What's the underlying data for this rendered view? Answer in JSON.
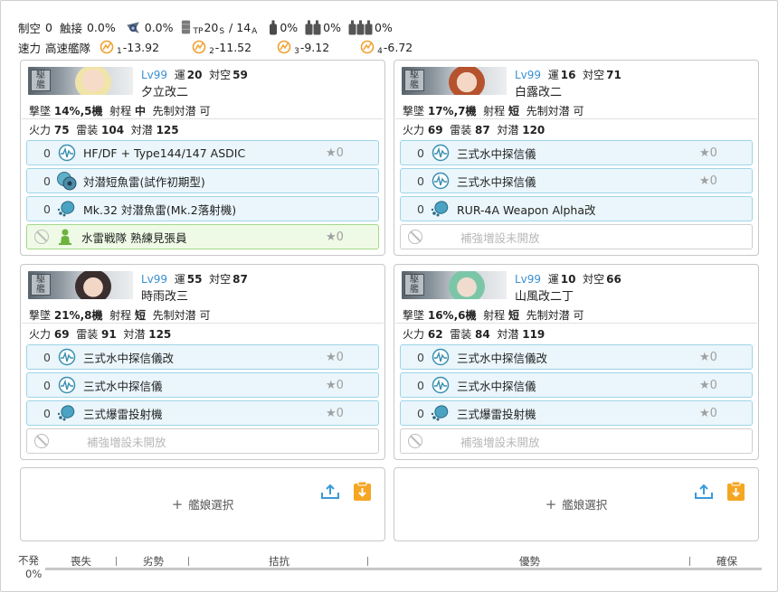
{
  "header": {
    "air_control_label": "制空",
    "air_control_value": "0",
    "contact_label": "触接",
    "contact_value": "0.0%",
    "recon_value": "0.0%",
    "tp_prefix": "TP",
    "tp_value": "20",
    "tp_sub_s": "S",
    "tp_sep": " / ",
    "tp_value_a": "14",
    "tp_sub_a": "A",
    "drum1_value": "0%",
    "drum2_value": "0%",
    "drum3_value": "0%",
    "speed_label": "速力",
    "speed_value": "高速艦隊",
    "formation1_sub": "1",
    "formation1_value": "-13.92",
    "formation2_sub": "2",
    "formation2_value": "-11.52",
    "formation3_sub": "3",
    "formation3_value": "-9.12",
    "formation4_sub": "4",
    "formation4_value": "-6.72"
  },
  "labels": {
    "lv": "Lv",
    "luck": "運",
    "aa": "対空",
    "shoot": "撃墜",
    "range": "射程",
    "preasw": "先制対潜",
    "fp": "火力",
    "torp": "雷装",
    "asw": "対潜",
    "star_prefix": "★",
    "unlock": "補強増設未開放",
    "select_ship": "艦娘選択",
    "plus": "+"
  },
  "ships": [
    {
      "level": "99",
      "luck": "20",
      "aa": "59",
      "name": "夕立改二",
      "shoot": "14%,5機",
      "range": "中",
      "preasw": "可",
      "fp": "75",
      "torp": "104",
      "asw": "125",
      "equips": [
        {
          "count": "0",
          "icon": "sonar-icon",
          "name": "HF/DF + Type144/147 ASDIC",
          "star": "0"
        },
        {
          "count": "0",
          "icon": "asw-torpedo-icon",
          "name": "対潜短魚雷(試作初期型)",
          "star": ""
        },
        {
          "count": "0",
          "icon": "depth-charge-icon",
          "name": "Mk.32 対潜魚雷(Mk.2落射機)",
          "star": ""
        },
        {
          "count": "",
          "icon": "crew-icon",
          "name": "水雷戦隊 熟練見張員",
          "star": "0"
        }
      ]
    },
    {
      "level": "99",
      "luck": "16",
      "aa": "71",
      "name": "白露改二",
      "shoot": "17%,7機",
      "range": "短",
      "preasw": "可",
      "fp": "69",
      "torp": "87",
      "asw": "120",
      "equips": [
        {
          "count": "0",
          "icon": "sonar-icon",
          "name": "三式水中探信儀",
          "star": "0"
        },
        {
          "count": "0",
          "icon": "sonar-icon",
          "name": "三式水中探信儀",
          "star": "0"
        },
        {
          "count": "0",
          "icon": "depth-charge-icon",
          "name": "RUR-4A Weapon Alpha改",
          "star": ""
        }
      ]
    },
    {
      "level": "99",
      "luck": "55",
      "aa": "87",
      "name": "時雨改三",
      "shoot": "21%,8機",
      "range": "短",
      "preasw": "可",
      "fp": "69",
      "torp": "91",
      "asw": "125",
      "equips": [
        {
          "count": "0",
          "icon": "sonar-icon",
          "name": "三式水中探信儀改",
          "star": "0"
        },
        {
          "count": "0",
          "icon": "sonar-icon",
          "name": "三式水中探信儀",
          "star": "0"
        },
        {
          "count": "0",
          "icon": "depth-charge-icon",
          "name": "三式爆雷投射機",
          "star": "0"
        }
      ]
    },
    {
      "level": "99",
      "luck": "10",
      "aa": "66",
      "name": "山風改二丁",
      "shoot": "16%,6機",
      "range": "短",
      "preasw": "可",
      "fp": "62",
      "torp": "84",
      "asw": "119",
      "equips": [
        {
          "count": "0",
          "icon": "sonar-icon",
          "name": "三式水中探信儀改",
          "star": "0"
        },
        {
          "count": "0",
          "icon": "sonar-icon",
          "name": "三式水中探信儀",
          "star": "0"
        },
        {
          "count": "0",
          "icon": "depth-charge-icon",
          "name": "三式爆雷投射機",
          "star": "0"
        }
      ]
    }
  ],
  "airbar": {
    "left_label": "不発",
    "left_value": "0%",
    "segments": [
      "喪失",
      "劣勢",
      "拮抗",
      "優勢",
      "確保"
    ]
  },
  "colors": {
    "accent_blue": "#3a8fd0",
    "equip_border": "#9fd4e8",
    "equip_bg": "#eaf6fb",
    "green_border": "#a3d88a",
    "green_bg": "#effae6",
    "formation_orange": "#f0a030",
    "clipboard_orange": "#f5a623"
  }
}
